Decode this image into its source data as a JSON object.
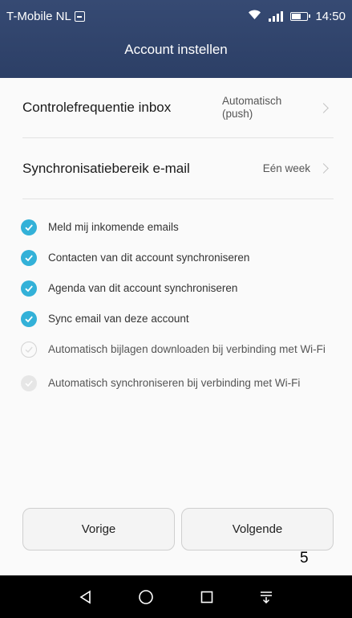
{
  "statusbar": {
    "carrier": "T-Mobile NL",
    "time": "14:50"
  },
  "header": {
    "title": "Account instellen"
  },
  "settings": [
    {
      "label": "Controlefrequentie inbox",
      "value_line1": "Automatisch",
      "value_line2": "(push)"
    },
    {
      "label": "Synchronisatiebereik e-mail",
      "value": "Eén week"
    }
  ],
  "options": [
    {
      "label": "Meld mij inkomende emails",
      "checked": true
    },
    {
      "label": "Contacten van dit account synchroniseren",
      "checked": true
    },
    {
      "label": "Agenda van dit account synchroniseren",
      "checked": true
    },
    {
      "label": "Sync email van deze account",
      "checked": true
    },
    {
      "label": "Automatisch bijlagen downloaden bij verbinding met Wi-Fi",
      "checked": false
    },
    {
      "label": "Automatisch synchroniseren bij verbinding met Wi-Fi",
      "checked": false
    }
  ],
  "buttons": {
    "prev": "Vorige",
    "next": "Volgende"
  },
  "page_number": "5",
  "colors": {
    "header": "#2f4269",
    "check": "#33b1d8"
  },
  "icons": {
    "nav": [
      "back-icon",
      "home-icon",
      "recents-icon",
      "notifications-icon"
    ]
  }
}
